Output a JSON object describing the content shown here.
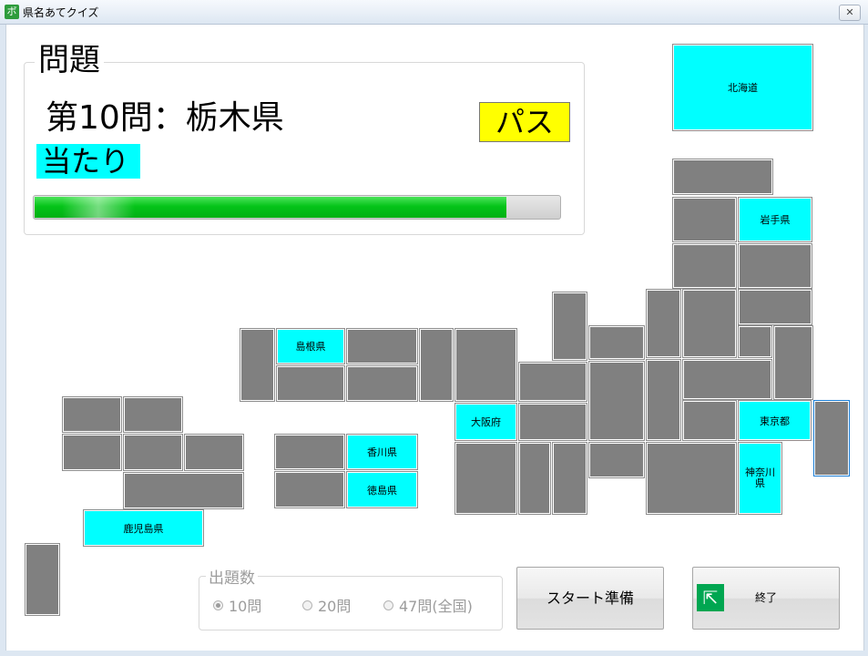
{
  "window": {
    "title": "県名あてクイズ",
    "app_icon_glyph": "ボ",
    "close_glyph": "✕"
  },
  "question_panel": {
    "legend": "問題",
    "question": "第10問：栃木県",
    "result": "当たり",
    "pass_label": "パス",
    "progress_percent": 90
  },
  "prefectures": {
    "hokkaido": "北海道",
    "iwate": "岩手県",
    "shimane": "島根県",
    "osaka": "大阪府",
    "tokyo": "東京都",
    "kagawa": "香川県",
    "tokushima": "徳島県",
    "kanagawa": "神奈川県",
    "kagoshima": "鹿児島県"
  },
  "question_count": {
    "legend": "出題数",
    "options": [
      "10問",
      "20問",
      "47問(全国)"
    ],
    "selected": 0
  },
  "buttons": {
    "start": "スタート準備",
    "exit": "終了"
  },
  "colors": {
    "correct": "#00ffff",
    "unanswered": "#808080",
    "pass": "#ffff00",
    "progress": "#05c419"
  }
}
